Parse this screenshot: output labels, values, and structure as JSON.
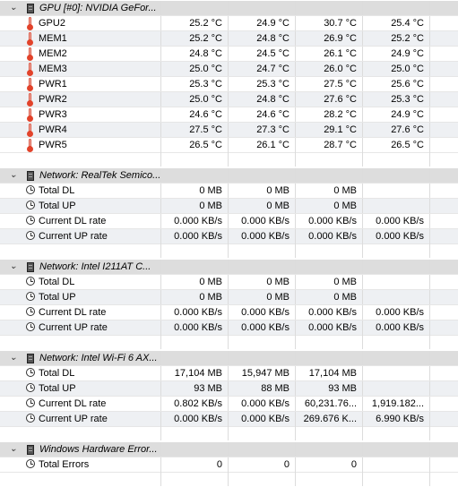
{
  "groups": [
    {
      "title": "GPU [#0]: NVIDIA GeFor...",
      "expand_glyph": "⌄",
      "icon": "chip-icon",
      "sensor_icon": "thermometer-icon",
      "rows": [
        {
          "label": "GPU2",
          "values": [
            "25.2 °C",
            "24.9 °C",
            "30.7 °C",
            "25.4 °C"
          ]
        },
        {
          "label": "MEM1",
          "values": [
            "25.2 °C",
            "24.8 °C",
            "26.9 °C",
            "25.2 °C"
          ]
        },
        {
          "label": "MEM2",
          "values": [
            "24.8 °C",
            "24.5 °C",
            "26.1 °C",
            "24.9 °C"
          ]
        },
        {
          "label": "MEM3",
          "values": [
            "25.0 °C",
            "24.7 °C",
            "26.0 °C",
            "25.0 °C"
          ]
        },
        {
          "label": "PWR1",
          "values": [
            "25.3 °C",
            "25.3 °C",
            "27.5 °C",
            "25.6 °C"
          ]
        },
        {
          "label": "PWR2",
          "values": [
            "25.0 °C",
            "24.8 °C",
            "27.6 °C",
            "25.3 °C"
          ]
        },
        {
          "label": "PWR3",
          "values": [
            "24.6 °C",
            "24.6 °C",
            "28.2 °C",
            "24.9 °C"
          ]
        },
        {
          "label": "PWR4",
          "values": [
            "27.5 °C",
            "27.3 °C",
            "29.1 °C",
            "27.6 °C"
          ]
        },
        {
          "label": "PWR5",
          "values": [
            "26.5 °C",
            "26.1 °C",
            "28.7 °C",
            "26.5 °C"
          ]
        }
      ]
    },
    {
      "title": "Network: RealTek Semico...",
      "expand_glyph": "⌄",
      "icon": "chip-icon",
      "sensor_icon": "clock-icon",
      "rows": [
        {
          "label": "Total DL",
          "values": [
            "0 MB",
            "0 MB",
            "0 MB",
            ""
          ]
        },
        {
          "label": "Total UP",
          "values": [
            "0 MB",
            "0 MB",
            "0 MB",
            ""
          ]
        },
        {
          "label": "Current DL rate",
          "values": [
            "0.000 KB/s",
            "0.000 KB/s",
            "0.000 KB/s",
            "0.000 KB/s"
          ]
        },
        {
          "label": "Current UP rate",
          "values": [
            "0.000 KB/s",
            "0.000 KB/s",
            "0.000 KB/s",
            "0.000 KB/s"
          ]
        }
      ]
    },
    {
      "title": "Network: Intel I211AT C...",
      "expand_glyph": "⌄",
      "icon": "chip-icon",
      "sensor_icon": "clock-icon",
      "rows": [
        {
          "label": "Total DL",
          "values": [
            "0 MB",
            "0 MB",
            "0 MB",
            ""
          ]
        },
        {
          "label": "Total UP",
          "values": [
            "0 MB",
            "0 MB",
            "0 MB",
            ""
          ]
        },
        {
          "label": "Current DL rate",
          "values": [
            "0.000 KB/s",
            "0.000 KB/s",
            "0.000 KB/s",
            "0.000 KB/s"
          ]
        },
        {
          "label": "Current UP rate",
          "values": [
            "0.000 KB/s",
            "0.000 KB/s",
            "0.000 KB/s",
            "0.000 KB/s"
          ]
        }
      ]
    },
    {
      "title": "Network: Intel Wi-Fi 6 AX...",
      "expand_glyph": "⌄",
      "icon": "chip-icon",
      "sensor_icon": "clock-icon",
      "rows": [
        {
          "label": "Total DL",
          "values": [
            "17,104 MB",
            "15,947 MB",
            "17,104 MB",
            ""
          ]
        },
        {
          "label": "Total UP",
          "values": [
            "93 MB",
            "88 MB",
            "93 MB",
            ""
          ]
        },
        {
          "label": "Current DL rate",
          "values": [
            "0.802 KB/s",
            "0.000 KB/s",
            "60,231.76...",
            "1,919.182..."
          ]
        },
        {
          "label": "Current UP rate",
          "values": [
            "0.000 KB/s",
            "0.000 KB/s",
            "269.676 K...",
            "6.990 KB/s"
          ]
        }
      ]
    },
    {
      "title": "Windows Hardware Error...",
      "expand_glyph": "⌄",
      "icon": "chip-icon",
      "sensor_icon": "clock-icon",
      "rows": [
        {
          "label": "Total Errors",
          "values": [
            "0",
            "0",
            "0",
            ""
          ]
        }
      ]
    }
  ],
  "colors": {
    "header_bg": "#dddddd",
    "alt_row_bg": "#eef0f3",
    "grid_line": "#dcdcdc",
    "thermo_red": "#e2432b"
  }
}
